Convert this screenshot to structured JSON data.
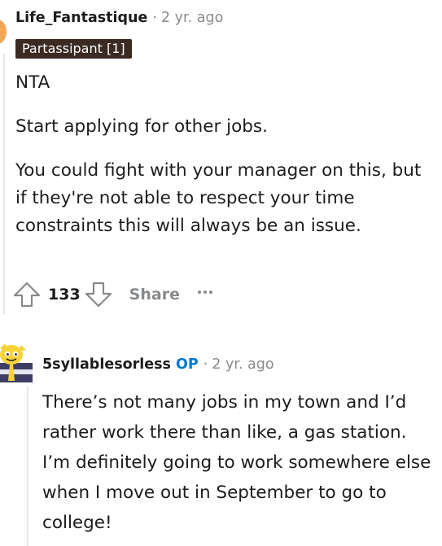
{
  "comments": [
    {
      "username": "Life_Fantastique",
      "separator": "·",
      "timestamp": "2 yr. ago",
      "flair": "Partassipant [1]",
      "paragraphs": [
        "NTA",
        "Start applying for other jobs.",
        "You could fight with your manager on this, but if they're not able to respect your time constraints this will always be an issue."
      ],
      "actions": {
        "upvote_icon": "arrow-up-outline-icon",
        "score": "133",
        "downvote_icon": "arrow-down-outline-icon",
        "share_label": "Share",
        "more_icon": "ellipsis-icon"
      }
    },
    {
      "username": "5syllablesorless",
      "op_badge": "OP",
      "separator": "·",
      "timestamp": "2 yr. ago",
      "avatar_icon": "snoo-avatar-icon",
      "paragraphs": [
        "There’s not many jobs in my town and I’d rather work there than like, a gas station. I’m definitely going to work somewhere else when I move out in September to go to college!"
      ]
    }
  ],
  "colors": {
    "text": "#1c1c1c",
    "meta": "#878a8c",
    "flair_bg": "#3b2a22",
    "op": "#0079d3",
    "avatar1": "#f2a65a"
  }
}
